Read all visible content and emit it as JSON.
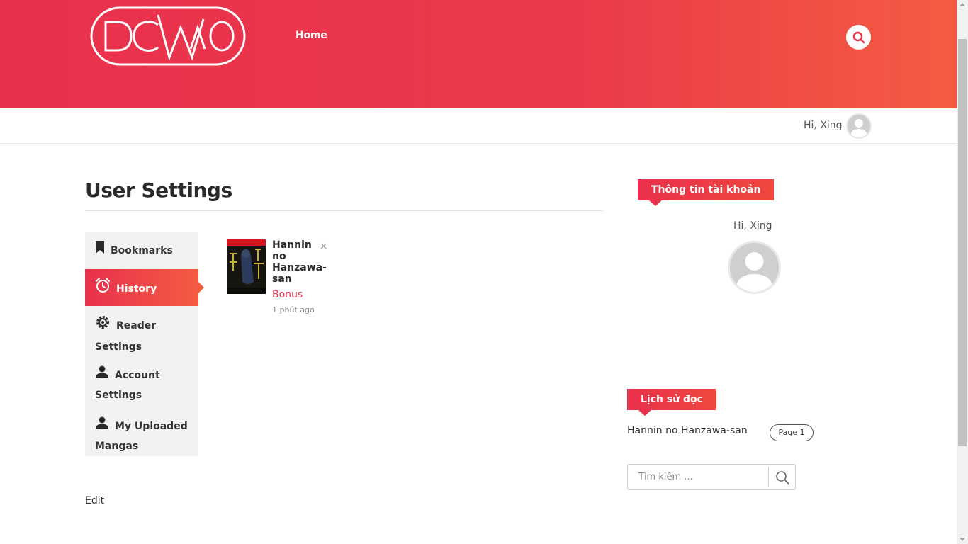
{
  "header": {
    "logo_text": "DCWAO",
    "nav_home": "Home"
  },
  "userbar": {
    "greeting": "Hi, Xing"
  },
  "main": {
    "page_title": "User Settings",
    "menu": [
      {
        "label": "Bookmarks",
        "icon": "bookmark-icon"
      },
      {
        "label": "History",
        "icon": "alarm-clock-icon",
        "active": true
      },
      {
        "label": "Reader Settings",
        "icon": "gear-icon"
      },
      {
        "label": "Account Settings",
        "icon": "person-icon"
      },
      {
        "label": "My Uploaded Mangas",
        "icon": "person-icon"
      }
    ],
    "history_items": [
      {
        "title": "Hannin no Hanzawa-san",
        "chapter": "Bonus",
        "time": "1 phút ago",
        "close": "×"
      }
    ],
    "edit_link": "Edit"
  },
  "sidebar": {
    "account_widget": {
      "heading": "Thông tin tài khoản",
      "greeting": "Hi, Xing"
    },
    "history_widget": {
      "heading": "Lịch sử đọc",
      "entries": [
        {
          "title": "Hannin no Hanzawa-san",
          "page": "Page 1"
        }
      ]
    },
    "search": {
      "placeholder": "Tìm kiếm ..."
    }
  },
  "colors": {
    "brand_start": "#e9304c",
    "brand_end": "#f45c42",
    "menu_bg": "#f2f2f2"
  }
}
